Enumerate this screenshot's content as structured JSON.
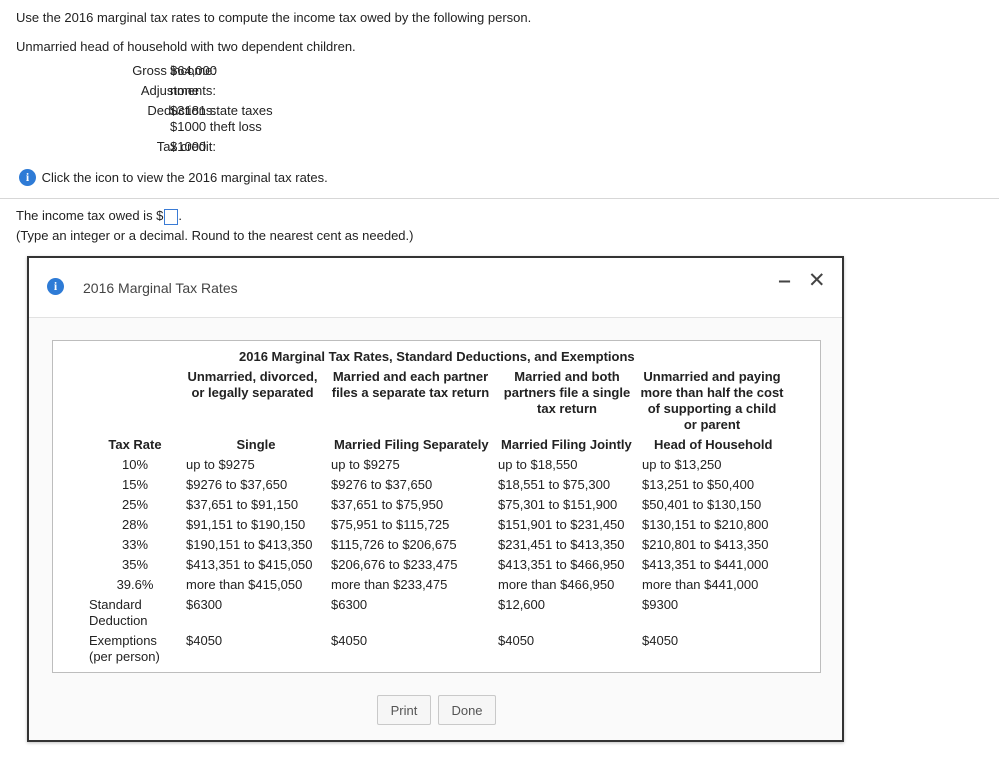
{
  "question": {
    "prompt": "Use the 2016 marginal tax rates to compute the income tax owed by the following person.",
    "person": "Unmarried head of household with two dependent children.",
    "details": [
      {
        "label": "Gross income:",
        "value": "$64,000"
      },
      {
        "label": "Adjustments:",
        "value": "none"
      },
      {
        "label": "Deductions:",
        "value": "$3181 state taxes",
        "value2": "$1000 theft loss"
      },
      {
        "label": "Tax credit:",
        "value": "$1000"
      }
    ],
    "info_link": "Click the icon to view the 2016 marginal tax rates.",
    "answer_prefix": "The income tax owed is $",
    "answer_suffix": ".",
    "answer_value": "",
    "hint": "(Type an integer or a decimal. Round to the nearest cent as needed.)"
  },
  "modal": {
    "title": "2016 Marginal Tax Rates",
    "minimize_glyph": "‒",
    "close_glyph": "✕",
    "table": {
      "title": "2016 Marginal Tax Rates, Standard Deductions, and Exemptions",
      "group_headers": [
        [
          "Unmarried, divorced,",
          "or legally separated"
        ],
        [
          "Married and each partner",
          "files a separate tax return"
        ],
        [
          "Married and both",
          "partners file a single",
          "tax return"
        ],
        [
          "Unmarried and paying",
          "more than half the cost",
          "of supporting a child",
          "or parent"
        ]
      ],
      "columns": [
        "Tax Rate",
        "Single",
        "Married Filing Separately",
        "Married Filing Jointly",
        "Head of Household"
      ],
      "rows": [
        [
          "10%",
          "up to $9275",
          "up to $9275",
          "up to $18,550",
          "up to $13,250"
        ],
        [
          "15%",
          "$9276 to $37,650",
          "$9276 to $37,650",
          "$18,551 to $75,300",
          "$13,251 to $50,400"
        ],
        [
          "25%",
          "$37,651 to $91,150",
          "$37,651 to $75,950",
          "$75,301 to $151,900",
          "$50,401 to $130,150"
        ],
        [
          "28%",
          "$91,151 to $190,150",
          "$75,951 to $115,725",
          "$151,901 to $231,450",
          "$130,151 to $210,800"
        ],
        [
          "33%",
          "$190,151 to $413,350",
          "$115,726 to $206,675",
          "$231,451 to $413,350",
          "$210,801 to $413,350"
        ],
        [
          "35%",
          "$413,351 to $415,050",
          "$206,676 to $233,475",
          "$413,351 to $466,950",
          "$413,351 to $441,000"
        ],
        [
          "39.6%",
          "more than $415,050",
          "more than $233,475",
          "more than $466,950",
          "more than $441,000"
        ]
      ],
      "standard_deduction": {
        "label1": "Standard",
        "label2": "Deduction",
        "values": [
          "$6300",
          "$6300",
          "$12,600",
          "$9300"
        ]
      },
      "exemptions": {
        "label1": "Exemptions",
        "label2": "(per person)",
        "values": [
          "$4050",
          "$4050",
          "$4050",
          "$4050"
        ]
      }
    },
    "buttons": {
      "print": "Print",
      "done": "Done"
    }
  }
}
